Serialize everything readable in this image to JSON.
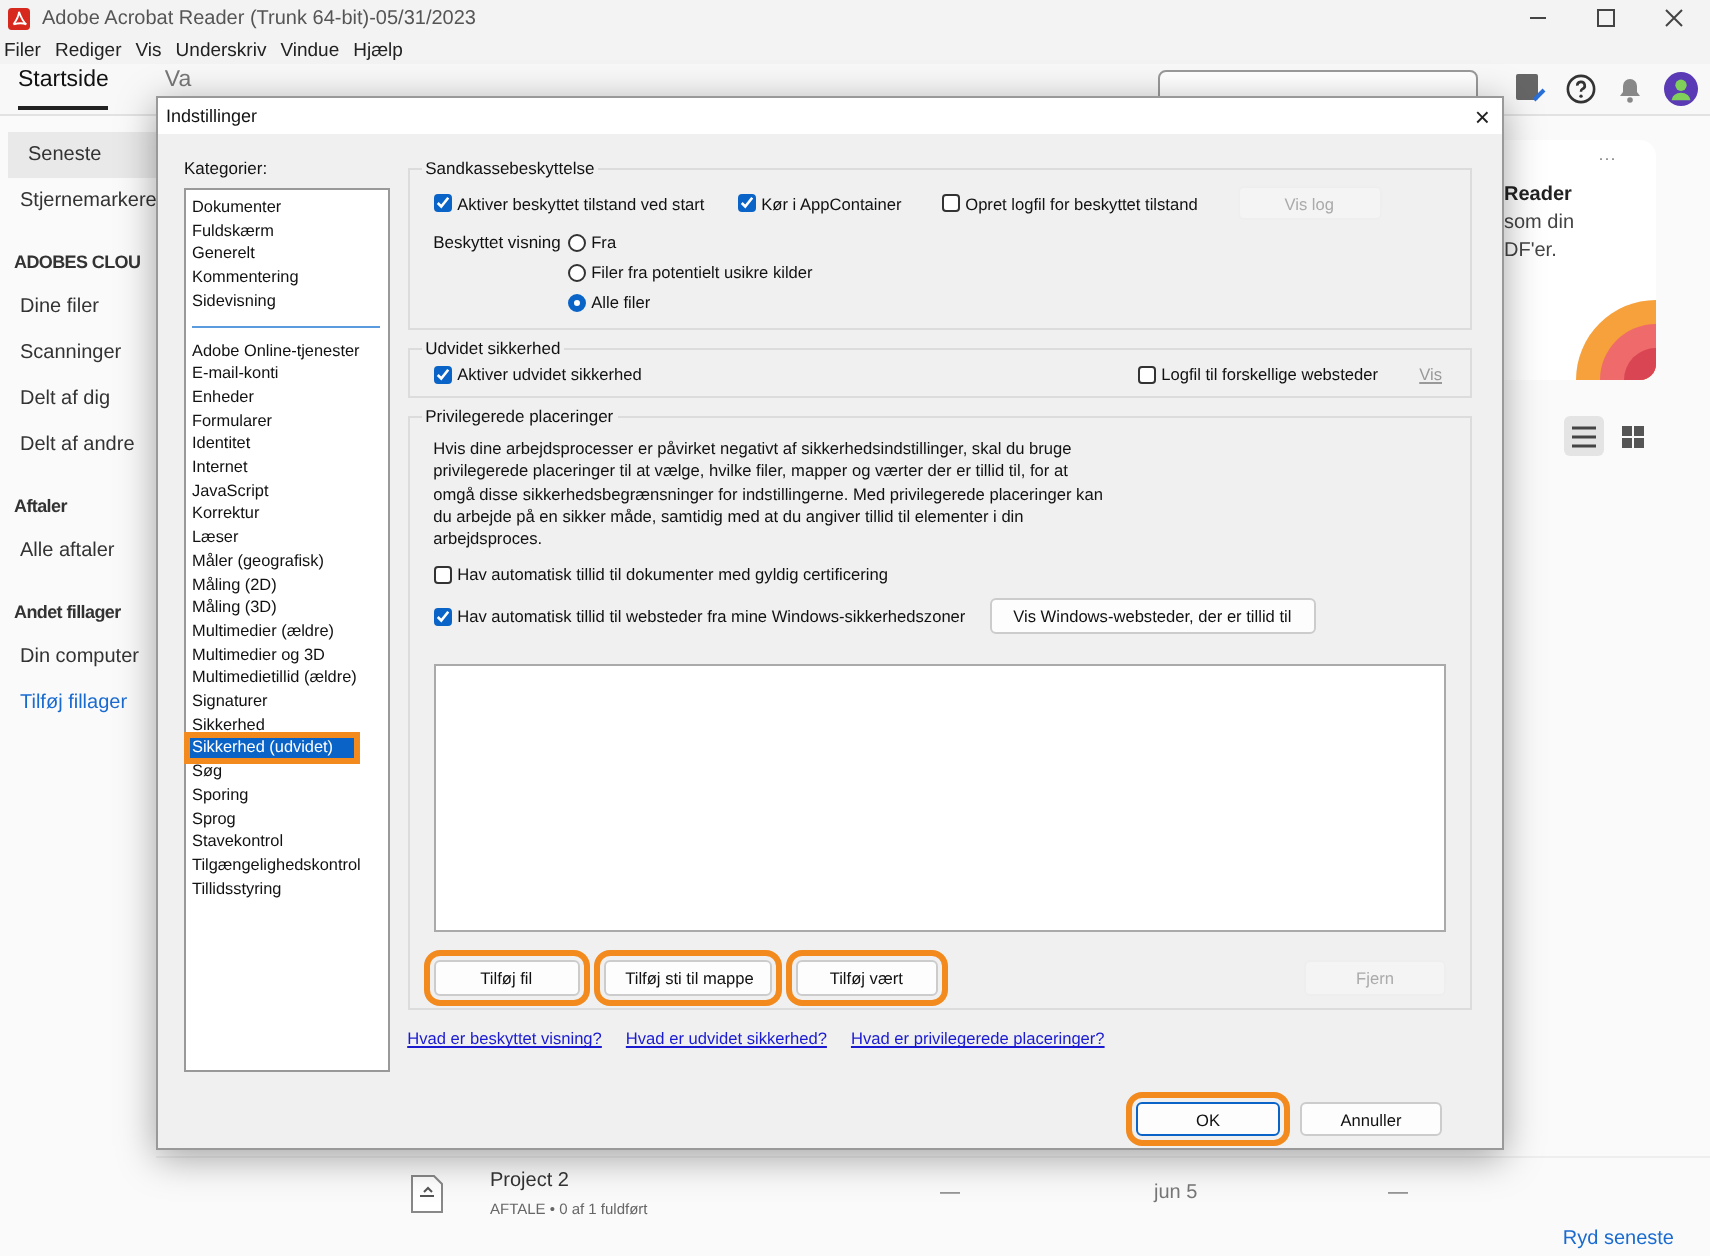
{
  "app": {
    "title": "Adobe Acrobat Reader (Trunk 64-bit)-05/31/2023",
    "menu": [
      "Filer",
      "Rediger",
      "Vis",
      "Underskriv",
      "Vindue",
      "Hjælp"
    ],
    "tabs": [
      {
        "label": "Startside",
        "selected": true
      },
      {
        "label": "Va",
        "selected": false
      }
    ],
    "sidebar": [
      {
        "label": "Seneste",
        "kind": "item",
        "selected": true
      },
      {
        "label": "Stjernemarkere",
        "kind": "item",
        "selected": false
      },
      {
        "label": "ADOBES CLOU",
        "kind": "heading",
        "selected": false
      },
      {
        "label": "Dine filer",
        "kind": "item",
        "selected": false
      },
      {
        "label": "Scanninger",
        "kind": "item",
        "selected": false
      },
      {
        "label": "Delt af dig",
        "kind": "item",
        "selected": false
      },
      {
        "label": "Delt af andre",
        "kind": "item",
        "selected": false
      },
      {
        "label": "Aftaler",
        "kind": "heading",
        "selected": false
      },
      {
        "label": "Alle aftaler",
        "kind": "item",
        "selected": false
      },
      {
        "label": "Andet fillager",
        "kind": "heading",
        "selected": false
      },
      {
        "label": "Din computer",
        "kind": "item",
        "selected": false
      },
      {
        "label": "Tilføj fillager",
        "kind": "link",
        "selected": false
      }
    ],
    "promo_card": {
      "title": "Reader",
      "menu": "···",
      "lines": [
        "som din",
        "DF'er."
      ]
    },
    "view_toggle": [
      {
        "kind": "list",
        "selected": true
      },
      {
        "kind": "grid",
        "selected": false
      }
    ],
    "recent": {
      "rows": [
        {
          "name": "Project 2",
          "details": "AFTALE • 0 af 1 fuldført",
          "column_3": "—",
          "date": "jun 5",
          "column_5": "—"
        }
      ],
      "clear_link": "Ryd seneste"
    }
  },
  "dialog": {
    "title": "Indstillinger",
    "close": "×",
    "categories": {
      "label": "Kategorier:",
      "groups": [
        [
          {
            "label": "Dokumenter",
            "selected": false,
            "highlighted": false
          },
          {
            "label": "Fuldskærm",
            "selected": false,
            "highlighted": false
          },
          {
            "label": "Generelt",
            "selected": false,
            "highlighted": false
          },
          {
            "label": "Kommentering",
            "selected": false,
            "highlighted": false
          },
          {
            "label": "Sidevisning",
            "selected": false,
            "highlighted": false
          }
        ],
        [
          {
            "label": "Adobe Online-tjenester",
            "selected": false,
            "highlighted": false
          },
          {
            "label": "E-mail-konti",
            "selected": false,
            "highlighted": false
          },
          {
            "label": "Enheder",
            "selected": false,
            "highlighted": false
          },
          {
            "label": "Formularer",
            "selected": false,
            "highlighted": false
          },
          {
            "label": "Identitet",
            "selected": false,
            "highlighted": false
          },
          {
            "label": "Internet",
            "selected": false,
            "highlighted": false
          },
          {
            "label": "JavaScript",
            "selected": false,
            "highlighted": false
          },
          {
            "label": "Korrektur",
            "selected": false,
            "highlighted": false
          },
          {
            "label": "Læser",
            "selected": false,
            "highlighted": false
          },
          {
            "label": "Måler (geografisk)",
            "selected": false,
            "highlighted": false
          },
          {
            "label": "Måling (2D)",
            "selected": false,
            "highlighted": false
          },
          {
            "label": "Måling (3D)",
            "selected": false,
            "highlighted": false
          },
          {
            "label": "Multimedier (ældre)",
            "selected": false,
            "highlighted": false
          },
          {
            "label": "Multimedier og 3D",
            "selected": false,
            "highlighted": false
          },
          {
            "label": "Multimedietillid (ældre)",
            "selected": false,
            "highlighted": false
          },
          {
            "label": "Signaturer",
            "selected": false,
            "highlighted": false
          },
          {
            "label": "Sikkerhed",
            "selected": false,
            "highlighted": false
          },
          {
            "label": "Sikkerhed (udvidet)",
            "selected": true,
            "highlighted": true
          },
          {
            "label": "Søg",
            "selected": false,
            "highlighted": false
          },
          {
            "label": "Sporing",
            "selected": false,
            "highlighted": false
          },
          {
            "label": "Sprog",
            "selected": false,
            "highlighted": false
          },
          {
            "label": "Stavekontrol",
            "selected": false,
            "highlighted": false
          },
          {
            "label": "Tilgængelighedskontrol",
            "selected": false,
            "highlighted": false
          },
          {
            "label": "Tillidsstyring",
            "selected": false,
            "highlighted": false
          }
        ]
      ]
    },
    "sandbox": {
      "title": "Sandkassebeskyttelse",
      "options": [
        {
          "label": "Aktiver beskyttet tilstand ved start",
          "checked": true
        },
        {
          "label": "Kør i AppContainer",
          "checked": true
        },
        {
          "label": "Opret logfil for beskyttet tilstand",
          "checked": false
        }
      ],
      "view_log_button": {
        "label": "Vis log",
        "disabled": true
      },
      "protected_view": {
        "label": "Beskyttet visning",
        "options": [
          {
            "label": "Fra",
            "selected": false
          },
          {
            "label": "Filer fra potentielt usikre kilder",
            "selected": false
          },
          {
            "label": "Alle filer",
            "selected": true
          }
        ]
      }
    },
    "enhanced": {
      "title": "Udvidet sikkerhed",
      "enable": {
        "label": "Aktiver udvidet sikkerhed",
        "checked": true
      },
      "log": {
        "label": "Logfil til forskellige websteder",
        "checked": false
      },
      "view_link": {
        "label": "Vis",
        "disabled": true
      }
    },
    "privileged": {
      "title": "Privilegerede placeringer",
      "description": "Hvis dine arbejdsprocesser er påvirket negativt af sikkerhedsindstillinger, skal du bruge privilegerede placeringer til at vælge, hvilke filer, mapper og værter der er tillid til, for at omgå disse sikkerhedsbegrænsninger for indstillingerne. Med privilegerede placeringer kan du arbejde på en sikker måde, samtidig med at du angiver tillid til elementer i din arbejdsproces.",
      "options": [
        {
          "label": "Hav automatisk tillid til dokumenter med gyldig certificering",
          "checked": false
        },
        {
          "label": "Hav automatisk tillid til websteder fra mine Windows-sikkerhedszoner",
          "checked": true
        }
      ],
      "trusted_sites_button": "Vis Windows-websteder, der er tillid til",
      "buttons": [
        {
          "label": "Tilføj fil",
          "disabled": false,
          "highlighted": true
        },
        {
          "label": "Tilføj sti til mappe",
          "disabled": false,
          "highlighted": true
        },
        {
          "label": "Tilføj vært",
          "disabled": false,
          "highlighted": true
        },
        {
          "label": "Fjern",
          "disabled": true,
          "highlighted": false
        }
      ]
    },
    "links": [
      "Hvad er beskyttet visning?",
      "Hvad er udvidet sikkerhed?",
      "Hvad er privilegerede placeringer?"
    ],
    "buttons": [
      {
        "label": "OK",
        "default": true,
        "highlighted": true
      },
      {
        "label": "Annuller",
        "default": false,
        "highlighted": false
      }
    ]
  }
}
